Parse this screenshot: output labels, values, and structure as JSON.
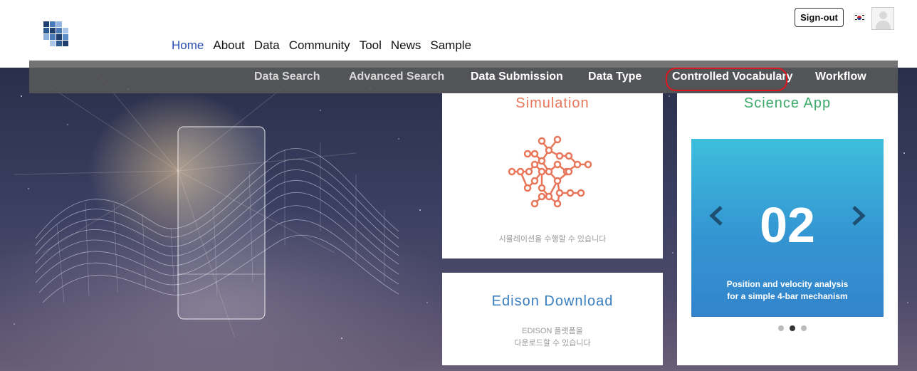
{
  "header": {
    "nav": [
      "Home",
      "About",
      "Data",
      "Community",
      "Tool",
      "News",
      "Sample"
    ],
    "signout_label": "Sign-out"
  },
  "subnav": {
    "items": [
      "Data Search",
      "Advanced Search",
      "Data Submission",
      "Data Type",
      "Controlled Vocabulary",
      "Workflow"
    ]
  },
  "cards": {
    "simulation": {
      "title": "Simulation",
      "subtitle": "시뮬레이션을 수행할 수 있습니다",
      "color": "#e8765a"
    },
    "science_app": {
      "title": "Science App",
      "color": "#3daa6a"
    },
    "edison": {
      "title": "Edison Download",
      "subtitle_line1": "EDISON 플랫폼을",
      "subtitle_line2": "다운로드할 수 있습니다",
      "color": "#3a7ec0"
    }
  },
  "slider": {
    "number": "02",
    "line1": "Position and velocity analysis",
    "line2": "for a simple 4-bar mechanism",
    "dots": 3,
    "active_dot": 2
  }
}
